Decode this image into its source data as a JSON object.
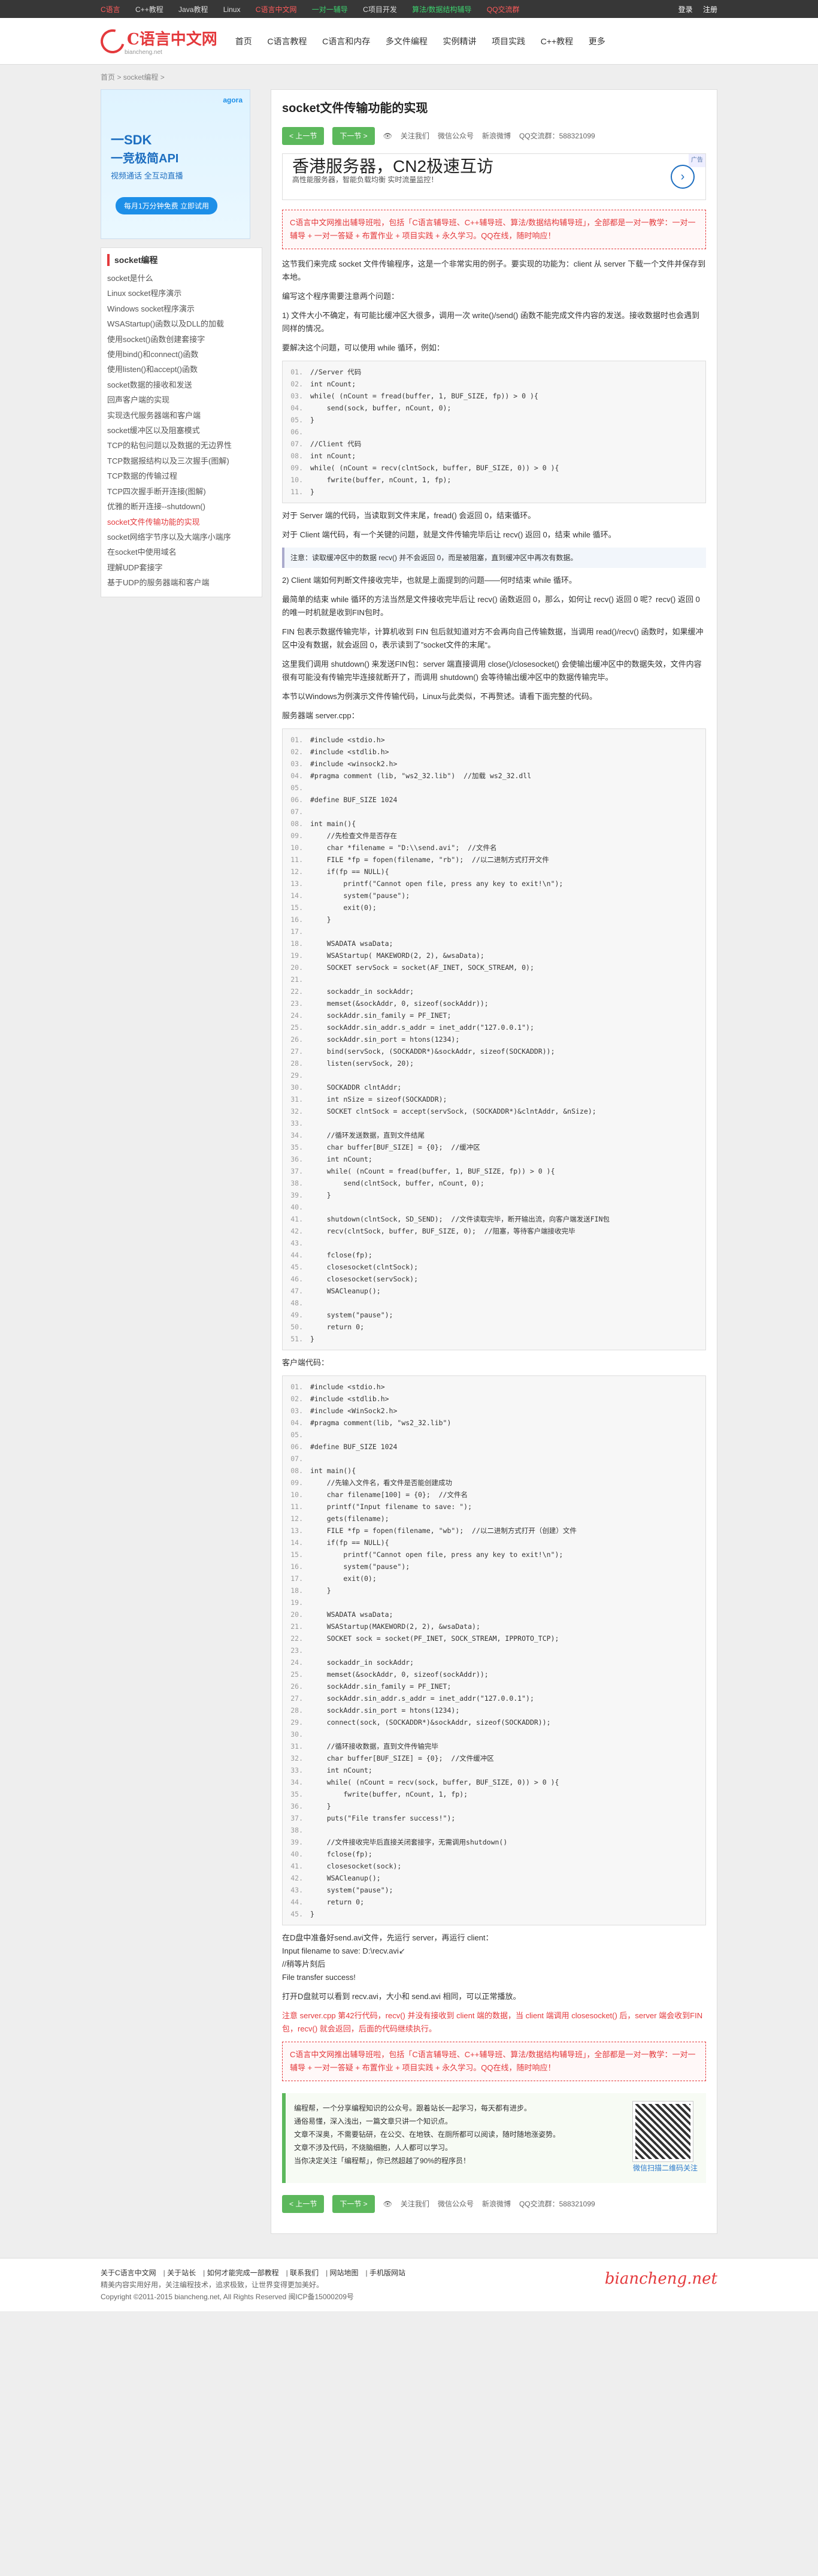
{
  "topbar": {
    "links": [
      "C语言",
      "C++教程",
      "Java教程",
      "Linux",
      "C语言中文网",
      "一对一辅导",
      "C项目开发",
      "算法/数据结构辅导",
      "QQ交流群"
    ],
    "login": "登录",
    "register": "注册"
  },
  "header": {
    "logo_text": "C语言中文网",
    "logo_sub": "biancheng.net",
    "nav": [
      "首页",
      "C语言教程",
      "C语言和内存",
      "多文件编程",
      "实例精讲",
      "项目实践",
      "C++教程",
      "更多"
    ]
  },
  "breadcrumb": [
    "首页",
    "socket编程"
  ],
  "sidebar": {
    "ad": {
      "brand": "agora",
      "line1": "一SDK",
      "line2": "一竞极简API",
      "tag": "视频通话 全互动直播",
      "cta": "每月1万分钟免费 立即试用"
    },
    "menu_title": "socket编程",
    "items": [
      "socket是什么",
      "Linux socket程序演示",
      "Windows socket程序演示",
      "WSAStartup()函数以及DLL的加载",
      "使用socket()函数创建套接字",
      "使用bind()和connect()函数",
      "使用listen()和accept()函数",
      "socket数据的接收和发送",
      "回声客户端的实现",
      "实现迭代服务器端和客户端",
      "socket缓冲区以及阻塞模式",
      "TCP的粘包问题以及数据的无边界性",
      "TCP数据报结构以及三次握手(图解)",
      "TCP数据的传输过程",
      "TCP四次握手断开连接(图解)",
      "优雅的断开连接--shutdown()",
      "socket文件传输功能的实现",
      "socket网络字节序以及大端序小端序",
      "在socket中使用域名",
      "理解UDP套接字",
      "基于UDP的服务器端和客户端"
    ],
    "active_index": 16
  },
  "article": {
    "title": "socket文件传输功能的实现",
    "prev": "< 上一节",
    "next": "下一节 >",
    "meta": [
      "关注我们",
      "微信公众号",
      "新浪微博",
      "QQ交流群：588321099"
    ],
    "ad_title": "香港服务器，CN2极速互访",
    "ad_sub": "高性能服务器，智能负载均衡 实时流量监控！",
    "ad_tag": "广告",
    "notice": "C语言中文网推出辅导班啦，包括「C语言辅导班、C++辅导班、算法/数据结构辅导班」，全部都是一对一教学：一对一辅导 + 一对一答疑 + 布置作业 + 项目实践 + 永久学习。QQ在线，随时响应！",
    "p1": "这节我们来完成 socket 文件传输程序，这是一个非常实用的例子。要实现的功能为：client 从 server 下载一个文件并保存到本地。",
    "p2": "编写这个程序需要注意两个问题：",
    "p3": "1) 文件大小不确定，有可能比缓冲区大很多，调用一次 write()/send() 函数不能完成文件内容的发送。接收数据时也会遇到同样的情况。",
    "p4": "要解决这个问题，可以使用 while 循环，例如：",
    "code1": [
      "//Server 代码",
      "int nCount;",
      "while( (nCount = fread(buffer, 1, BUF_SIZE, fp)) > 0 ){",
      "    send(sock, buffer, nCount, 0);",
      "}",
      "",
      "//Client 代码",
      "int nCount;",
      "while( (nCount = recv(clntSock, buffer, BUF_SIZE, 0)) > 0 ){",
      "    fwrite(buffer, nCount, 1, fp);",
      "}"
    ],
    "p5": "对于 Server 端的代码，当读取到文件末尾，fread() 会返回 0，结束循环。",
    "p6": "对于 Client 端代码，有一个关键的问题，就是文件传输完毕后让 recv() 返回 0，结束 while 循环。",
    "tip": "注意：读取缓冲区中的数据 recv() 并不会返回 0，而是被阻塞，直到缓冲区中再次有数据。",
    "p7": "2) Client 端如何判断文件接收完毕，也就是上面提到的问题——何时结束 while 循环。",
    "p8": "最简单的结束 while 循环的方法当然是文件接收完毕后让 recv() 函数返回 0，那么，如何让 recv() 返回 0 呢？recv() 返回 0 的唯一时机就是收到FIN包时。",
    "p9": "FIN 包表示数据传输完毕，计算机收到 FIN 包后就知道对方不会再向自己传输数据，当调用 read()/recv() 函数时，如果缓冲区中没有数据，就会返回 0，表示读到了”socket文件的末尾“。",
    "p10": "这里我们调用 shutdown() 来发送FIN包：server 端直接调用 close()/closesocket() 会使输出缓冲区中的数据失效，文件内容很有可能没有传输完毕连接就断开了，而调用 shutdown() 会等待输出缓冲区中的数据传输完毕。",
    "p11": "本节以Windows为例演示文件传输代码，Linux与此类似，不再赘述。请看下面完整的代码。",
    "p12": "服务器端 server.cpp：",
    "code2": [
      "#include <stdio.h>",
      "#include <stdlib.h>",
      "#include <winsock2.h>",
      "#pragma comment (lib, \"ws2_32.lib\")  //加载 ws2_32.dll",
      "",
      "#define BUF_SIZE 1024",
      "",
      "int main(){",
      "    //先检查文件是否存在",
      "    char *filename = \"D:\\\\send.avi\";  //文件名",
      "    FILE *fp = fopen(filename, \"rb\");  //以二进制方式打开文件",
      "    if(fp == NULL){",
      "        printf(\"Cannot open file, press any key to exit!\\n\");",
      "        system(\"pause\");",
      "        exit(0);",
      "    }",
      "",
      "    WSADATA wsaData;",
      "    WSAStartup( MAKEWORD(2, 2), &wsaData);",
      "    SOCKET servSock = socket(AF_INET, SOCK_STREAM, 0);",
      "",
      "    sockaddr_in sockAddr;",
      "    memset(&sockAddr, 0, sizeof(sockAddr));",
      "    sockAddr.sin_family = PF_INET;",
      "    sockAddr.sin_addr.s_addr = inet_addr(\"127.0.0.1\");",
      "    sockAddr.sin_port = htons(1234);",
      "    bind(servSock, (SOCKADDR*)&sockAddr, sizeof(SOCKADDR));",
      "    listen(servSock, 20);",
      "",
      "    SOCKADDR clntAddr;",
      "    int nSize = sizeof(SOCKADDR);",
      "    SOCKET clntSock = accept(servSock, (SOCKADDR*)&clntAddr, &nSize);",
      "",
      "    //循环发送数据，直到文件结尾",
      "    char buffer[BUF_SIZE] = {0};  //缓冲区",
      "    int nCount;",
      "    while( (nCount = fread(buffer, 1, BUF_SIZE, fp)) > 0 ){",
      "        send(clntSock, buffer, nCount, 0);",
      "    }",
      "",
      "    shutdown(clntSock, SD_SEND);  //文件读取完毕，断开输出流，向客户端发送FIN包",
      "    recv(clntSock, buffer, BUF_SIZE, 0);  //阻塞，等待客户端接收完毕",
      "",
      "    fclose(fp);",
      "    closesocket(clntSock);",
      "    closesocket(servSock);",
      "    WSACleanup();",
      "",
      "    system(\"pause\");",
      "    return 0;",
      "}"
    ],
    "p13": "客户端代码：",
    "code3": [
      "#include <stdio.h>",
      "#include <stdlib.h>",
      "#include <WinSock2.h>",
      "#pragma comment(lib, \"ws2_32.lib\")",
      "",
      "#define BUF_SIZE 1024",
      "",
      "int main(){",
      "    //先输入文件名，看文件是否能创建成功",
      "    char filename[100] = {0};  //文件名",
      "    printf(\"Input filename to save: \");",
      "    gets(filename);",
      "    FILE *fp = fopen(filename, \"wb\");  //以二进制方式打开（创建）文件",
      "    if(fp == NULL){",
      "        printf(\"Cannot open file, press any key to exit!\\n\");",
      "        system(\"pause\");",
      "        exit(0);",
      "    }",
      "",
      "    WSADATA wsaData;",
      "    WSAStartup(MAKEWORD(2, 2), &wsaData);",
      "    SOCKET sock = socket(PF_INET, SOCK_STREAM, IPPROTO_TCP);",
      "",
      "    sockaddr_in sockAddr;",
      "    memset(&sockAddr, 0, sizeof(sockAddr));",
      "    sockAddr.sin_family = PF_INET;",
      "    sockAddr.sin_addr.s_addr = inet_addr(\"127.0.0.1\");",
      "    sockAddr.sin_port = htons(1234);",
      "    connect(sock, (SOCKADDR*)&sockAddr, sizeof(SOCKADDR));",
      "",
      "    //循环接收数据，直到文件传输完毕",
      "    char buffer[BUF_SIZE] = {0};  //文件缓冲区",
      "    int nCount;",
      "    while( (nCount = recv(sock, buffer, BUF_SIZE, 0)) > 0 ){",
      "        fwrite(buffer, nCount, 1, fp);",
      "    }",
      "    puts(\"File transfer success!\");",
      "",
      "    //文件接收完毕后直接关闭套接字，无需调用shutdown()",
      "    fclose(fp);",
      "    closesocket(sock);",
      "    WSACleanup();",
      "    system(\"pause\");",
      "    return 0;",
      "}"
    ],
    "result": [
      "在D盘中准备好send.avi文件，先运行 server，再运行 client：",
      "Input filename to save: D:\\recv.avi↙",
      "//稍等片刻后",
      "File transfer success!"
    ],
    "p14": "打开D盘就可以看到 recv.avi，大小和 send.avi 相同，可以正常播放。",
    "p15": "注意 server.cpp 第42行代码，recv() 并没有接收到 client 端的数据，当 client 端调用 closesocket() 后，server 端会收到FIN包，recv() 就会返回，后面的代码继续执行。",
    "notice2": "C语言中文网推出辅导班啦，包括「C语言辅导班、C++辅导班、算法/数据结构辅导班」，全部都是一对一教学：一对一辅导 + 一对一答疑 + 布置作业 + 项目实践 + 永久学习。QQ在线，随时响应！",
    "promo": [
      "编程帮，一个分享编程知识的公众号。跟着站长一起学习，每天都有进步。",
      "通俗易懂，深入浅出，一篇文章只讲一个知识点。",
      "文章不深奥，不需要钻研，在公交、在地铁、在厕所都可以阅读，随时随地涨姿势。",
      "文章不涉及代码，不烧脑细胞，人人都可以学习。",
      "当你决定关注「编程帮」，你已然超越了90%的程序员！"
    ],
    "qr_caption": "微信扫描二维码关注"
  },
  "footer": {
    "links": [
      "关于C语言中文网",
      "关于站长",
      "如何才能完成一部教程",
      "联系我们",
      "网站地图",
      "手机版网站"
    ],
    "line1": "精美内容实用好用，关注编程技术，追求极致，让世界变得更加美好。",
    "copyright": "Copyright ©2011-2015 biancheng.net, All Rights Reserved   闽ICP备15000209号",
    "brand": "biancheng.net"
  }
}
